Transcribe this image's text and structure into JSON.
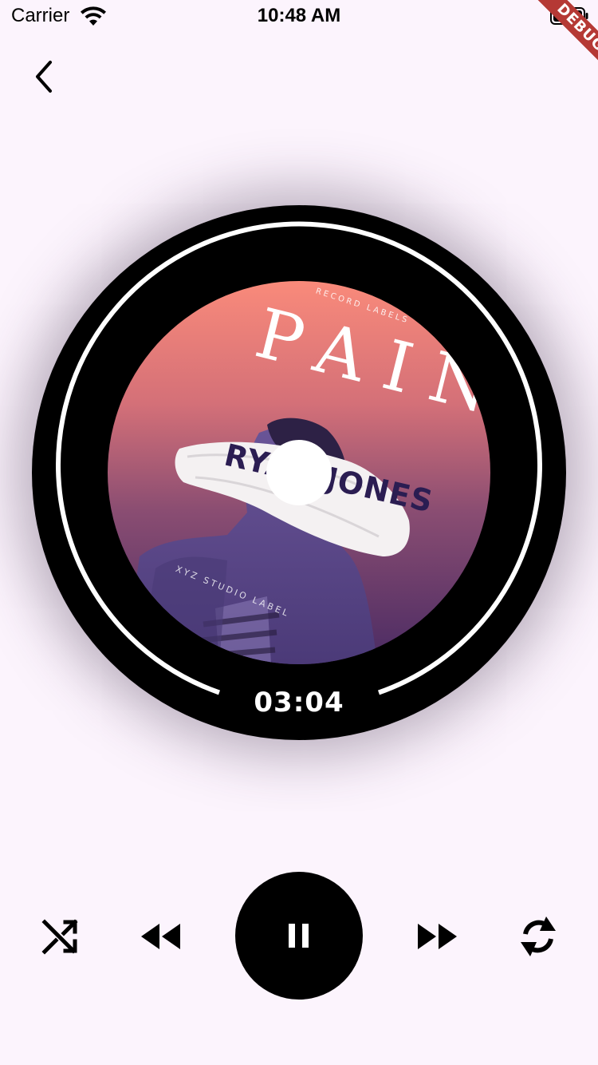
{
  "status_bar": {
    "carrier": "Carrier",
    "time": "10:48 AM",
    "wifi_icon": "wifi-icon",
    "battery_icon": "battery-icon"
  },
  "debug_banner": {
    "label": "DEBUG",
    "color": "#b53935"
  },
  "nav": {
    "back_icon": "chevron-left-icon"
  },
  "album": {
    "label_top": "RECORD LABELS",
    "title": "PAIN",
    "artist": "RYAN JONES",
    "label_bottom": "XYZ STUDIO LABEL",
    "gradient_top": "#f98a7a",
    "gradient_bottom": "#4a2b63"
  },
  "player": {
    "elapsed": "03:04",
    "progress_fraction": 1.0,
    "state": "playing"
  },
  "controls": {
    "shuffle_icon": "shuffle-icon",
    "rewind_icon": "rewind-icon",
    "pause_icon": "pause-icon",
    "forward_icon": "fast-forward-icon",
    "repeat_icon": "repeat-icon"
  },
  "colors": {
    "background": "#fcf4fd",
    "disc": "#000000",
    "ring": "#ffffff"
  }
}
